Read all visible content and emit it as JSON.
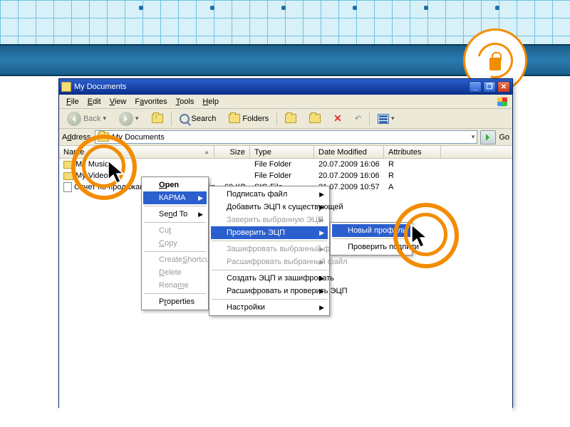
{
  "window": {
    "title": "My Documents"
  },
  "menu": {
    "file": "File",
    "edit": "Edit",
    "view": "View",
    "favorites": "Favorites",
    "tools": "Tools",
    "help": "Help"
  },
  "toolbar": {
    "back": "Back",
    "search": "Search",
    "folders": "Folders"
  },
  "address": {
    "label": "Address",
    "value": "My Documents",
    "go": "Go"
  },
  "columns": {
    "name": "Name",
    "size": "Size",
    "type": "Type",
    "date": "Date Modified",
    "attr": "Attributes"
  },
  "files": [
    {
      "name": "My Music",
      "size": "",
      "type": "File Folder",
      "date": "20.07.2009 16:06",
      "attr": "R",
      "icon": "folder"
    },
    {
      "name": "My Videos",
      "size": "",
      "type": "File Folder",
      "date": "20.07.2009 16:06",
      "attr": "R",
      "icon": "folder"
    },
    {
      "name": "Отчет по продажам за 1кв 2009г.xls.sig",
      "size": "69 KB",
      "type": "SIG File",
      "date": "21.07.2009 10:57",
      "attr": "A",
      "icon": "sig"
    }
  ],
  "ctx1": {
    "open": "Open",
    "karma": "КАРМА",
    "sendto": "Send To",
    "cut": "Cut",
    "copy": "Copy",
    "shortcut": "Create Shortcut",
    "delete": "Delete",
    "rename": "Rename",
    "properties": "Properties"
  },
  "ctx2": {
    "sign": "Подписать файл",
    "addsig": "Добавить ЭЦП к существующей",
    "verifysel": "Заверить выбранную ЭЦП",
    "verify": "Проверить ЭЦП",
    "encryptsel": "Зашифровать выбранный файл",
    "decryptsel": "Расшифровать выбранный файл",
    "signenc": "Создать ЭЦП и зашифровать",
    "decver": "Расшифровать и проверить ЭЦП",
    "settings": "Настройки"
  },
  "ctx3": {
    "newprofile": "Новый профиль",
    "checksigs": "Проверить подписи"
  }
}
